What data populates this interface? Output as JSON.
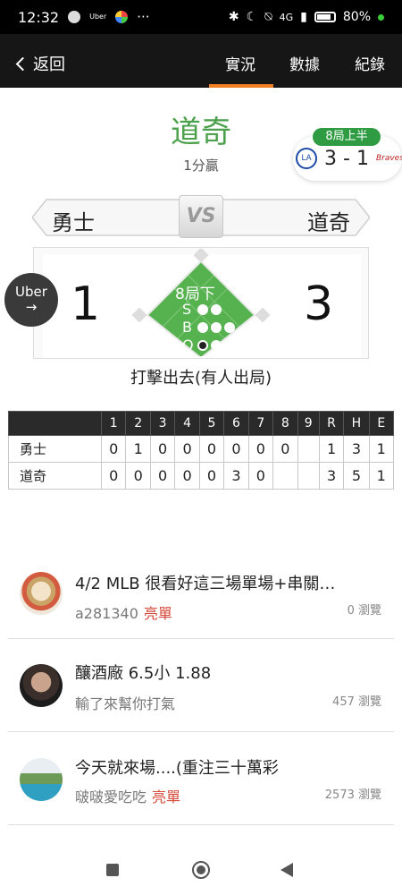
{
  "status_bar": {
    "time": "12:32",
    "uber_mini": "Uber",
    "network": "4G",
    "battery": "80%"
  },
  "nav": {
    "back_label": "返回",
    "tabs": [
      {
        "label": "實況",
        "active": true
      },
      {
        "label": "數據",
        "active": false
      },
      {
        "label": "紀錄",
        "active": false
      }
    ]
  },
  "game": {
    "winner_title": "道奇",
    "win_margin": "1分贏",
    "mini_badge": "8局上半",
    "mini_score": "3 - 1",
    "mini_logo_home": "LA",
    "mini_logo_away": "Braves",
    "team_left": "勇士",
    "team_right": "道奇",
    "vs_label": "VS",
    "score_left": "1",
    "score_right": "3",
    "inning": "8局下",
    "count": {
      "s_label": "S",
      "s_count": 0,
      "s_max": 2,
      "b_label": "B",
      "b_count": 0,
      "b_max": 3,
      "o_label": "O",
      "o_count": 1,
      "o_max": 3
    },
    "play_result": "打擊出去(有人出局)"
  },
  "ad_bubble": {
    "label": "Uber",
    "arrow": "→"
  },
  "boxscore": {
    "headers": [
      "1",
      "2",
      "3",
      "4",
      "5",
      "6",
      "7",
      "8",
      "9",
      "R",
      "H",
      "E"
    ],
    "rows": [
      {
        "team": "勇士",
        "innings": [
          "0",
          "1",
          "0",
          "0",
          "0",
          "0",
          "0",
          "0",
          ""
        ],
        "rhe": [
          "1",
          "3",
          "1"
        ]
      },
      {
        "team": "道奇",
        "innings": [
          "0",
          "0",
          "0",
          "0",
          "0",
          "3",
          "0",
          "",
          ""
        ],
        "rhe": [
          "3",
          "5",
          "1"
        ]
      }
    ]
  },
  "posts": [
    {
      "title": "4/2 MLB 很看好這三場單場+串關…",
      "author": "a281340",
      "tag": "亮單",
      "views": "0 瀏覽",
      "avatar": "avatar-food"
    },
    {
      "title": "釀酒廠 6.5小 1.88",
      "author": "輸了來幫你打氣",
      "tag": "",
      "views": "457 瀏覽",
      "avatar": "avatar-man"
    },
    {
      "title": "今天就來場....(重注三十萬彩",
      "author": "啵啵愛吃吃",
      "tag": "亮單",
      "views": "2573 瀏覽",
      "avatar": "avatar-pool"
    }
  ]
}
